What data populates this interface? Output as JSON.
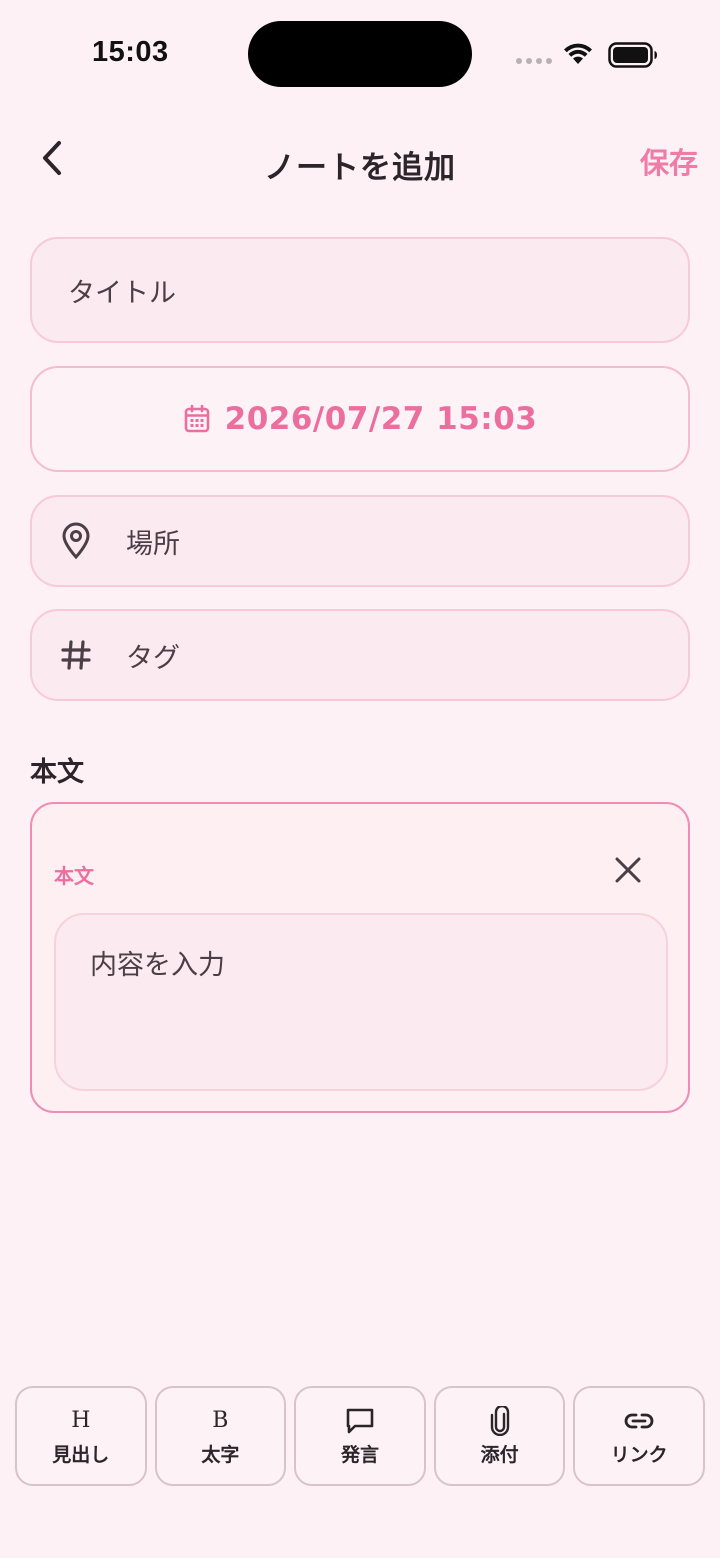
{
  "status_bar": {
    "time": "15:03"
  },
  "header": {
    "title": "ノートを追加",
    "save_label": "保存"
  },
  "form": {
    "title_placeholder": "タイトル",
    "date_value": "2026/07/27 15:03",
    "place_placeholder": "場所",
    "tag_placeholder": "タグ"
  },
  "body_section": {
    "label": "本文",
    "card_label": "本文",
    "content_placeholder": "内容を入力"
  },
  "toolbar": {
    "items": [
      {
        "icon_text": "H",
        "label": "見出し",
        "icon": "heading-icon"
      },
      {
        "icon_text": "B",
        "label": "太字",
        "icon": "bold-icon"
      },
      {
        "icon_text": "",
        "label": "発言",
        "icon": "speech-bubble-icon"
      },
      {
        "icon_text": "",
        "label": "添付",
        "icon": "paperclip-icon"
      },
      {
        "icon_text": "",
        "label": "リンク",
        "icon": "link-icon"
      }
    ]
  },
  "colors": {
    "accent": "#ec6e9f",
    "background": "#fdf1f5",
    "field_bg": "#fceaf1",
    "border": "#f6cad8"
  }
}
